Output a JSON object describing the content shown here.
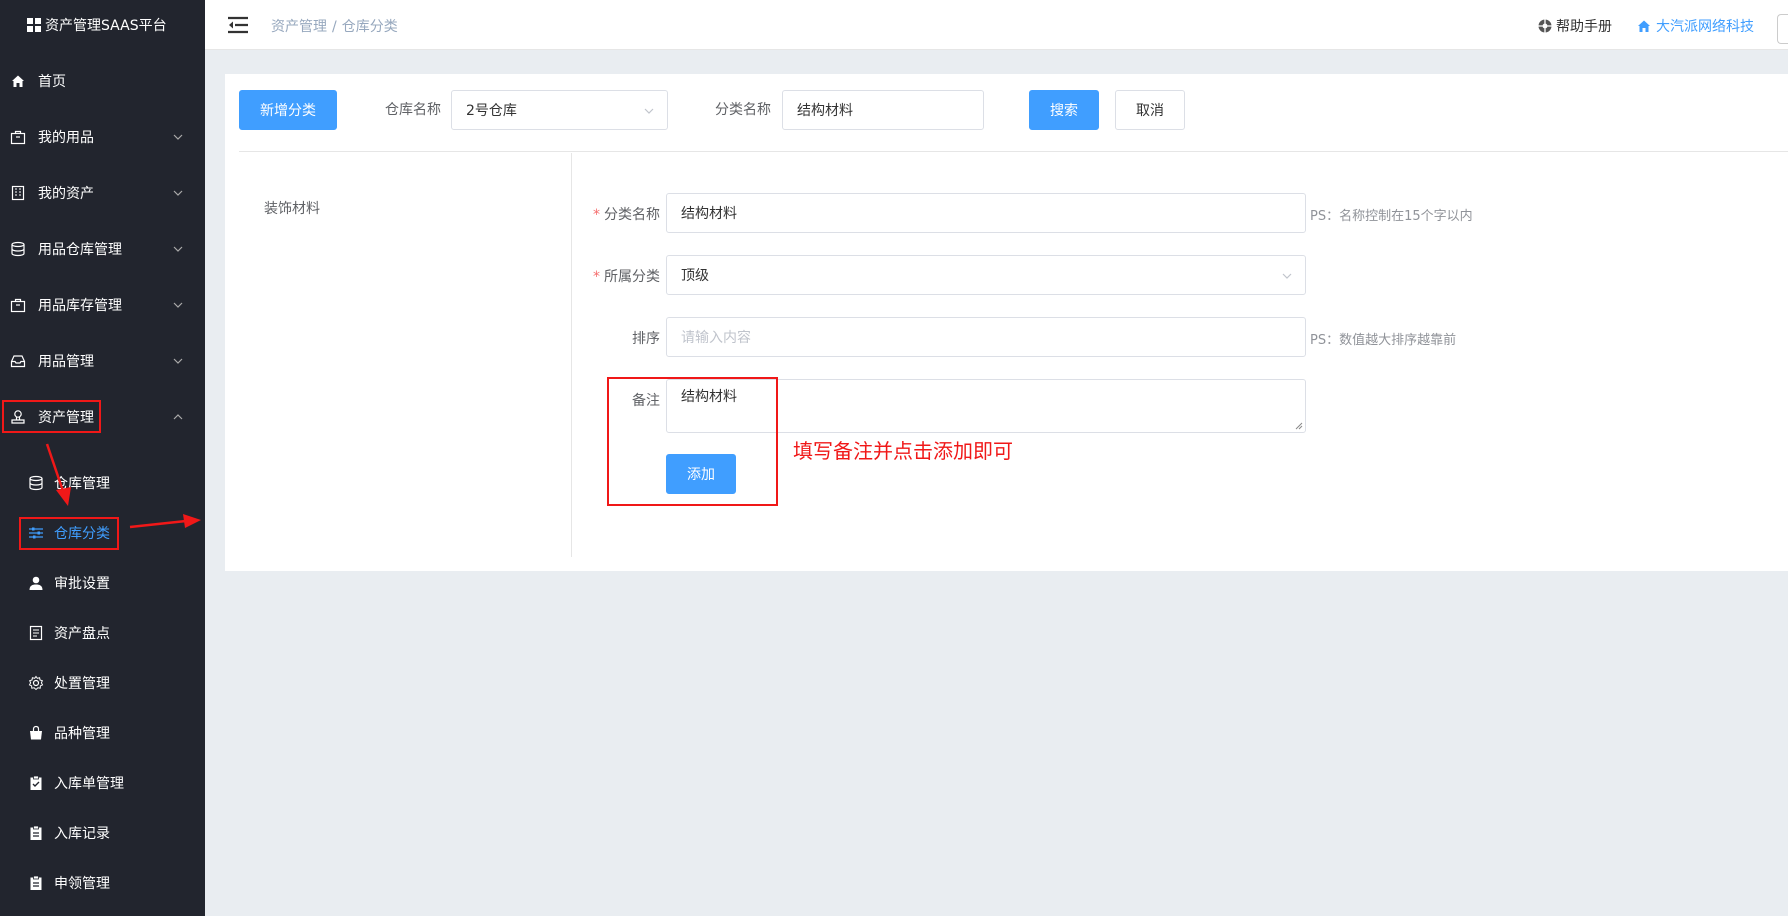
{
  "app": {
    "title": "资产管理SAAS平台"
  },
  "sidebar": {
    "items": [
      {
        "label": "首页",
        "icon": "home-icon"
      },
      {
        "label": "我的用品",
        "icon": "bag-icon"
      },
      {
        "label": "我的资产",
        "icon": "building-icon"
      },
      {
        "label": "用品仓库管理",
        "icon": "database-icon"
      },
      {
        "label": "用品库存管理",
        "icon": "bag-icon"
      },
      {
        "label": "用品管理",
        "icon": "inbox-icon"
      },
      {
        "label": "资产管理",
        "icon": "stamp-icon"
      }
    ],
    "sub_items": [
      {
        "label": "仓库管理",
        "icon": "database-icon"
      },
      {
        "label": "仓库分类",
        "icon": "sliders-icon"
      },
      {
        "label": "审批设置",
        "icon": "user-icon"
      },
      {
        "label": "资产盘点",
        "icon": "document-icon"
      },
      {
        "label": "处置管理",
        "icon": "gear-icon"
      },
      {
        "label": "品种管理",
        "icon": "shopping-bag-icon"
      },
      {
        "label": "入库单管理",
        "icon": "clipboard-check-icon"
      },
      {
        "label": "入库记录",
        "icon": "clipboard-icon"
      },
      {
        "label": "申领管理",
        "icon": "clipboard-icon"
      }
    ]
  },
  "header": {
    "breadcrumb": [
      "资产管理",
      "仓库分类"
    ],
    "breadcrumb_sep": "/",
    "help": "帮助手册",
    "company": "大汽派网络科技"
  },
  "toolbar": {
    "add_button": "新增分类",
    "warehouse_label": "仓库名称",
    "warehouse_value": "2号仓库",
    "category_label": "分类名称",
    "category_value": "结构材料",
    "search_button": "搜索",
    "cancel_button": "取消"
  },
  "tree": {
    "nodes": [
      "装饰材料"
    ]
  },
  "form": {
    "name_label": "分类名称",
    "name_value": "结构材料",
    "name_hint": "PS：名称控制在15个字以内",
    "parent_label": "所属分类",
    "parent_value": "顶级",
    "sort_label": "排序",
    "sort_placeholder": "请输入内容",
    "sort_hint": "PS：数值越大排序越靠前",
    "remark_label": "备注",
    "remark_value": "结构材料",
    "submit_button": "添加"
  },
  "annotation": {
    "text": "填写备注并点击添加即可"
  },
  "colors": {
    "primary": "#409eff",
    "sidebar_bg": "#22252e",
    "annotation_red": "#f01818"
  }
}
